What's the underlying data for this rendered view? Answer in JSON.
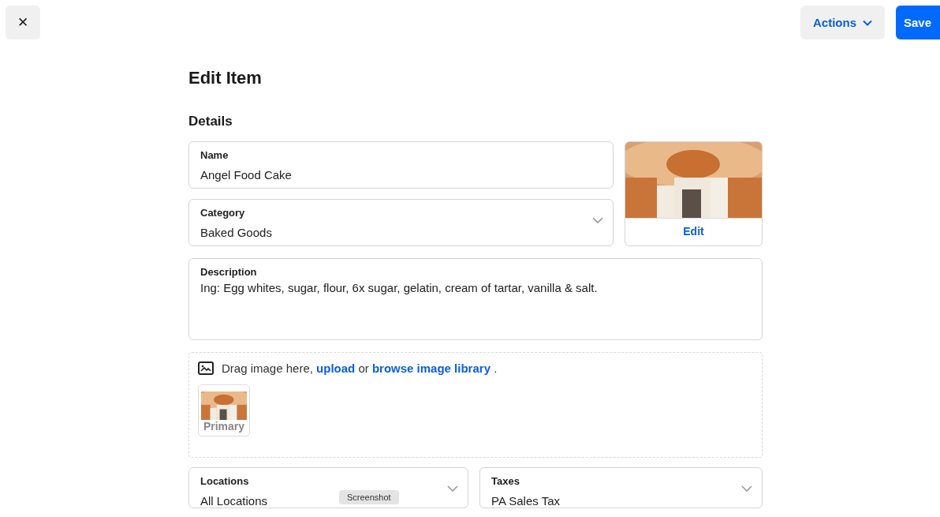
{
  "header": {
    "close": "✕",
    "actions": "Actions",
    "save": "Save"
  },
  "title": "Edit Item",
  "section": "Details",
  "name_field": {
    "label": "Name",
    "value": "Angel Food Cake"
  },
  "category_field": {
    "label": "Category",
    "value": "Baked Goods"
  },
  "image_card": {
    "kind": "picture",
    "edit": "Edit"
  },
  "description_field": {
    "label": "Description",
    "value": "Ing: Egg whites, sugar, flour, 6x sugar, gelatin, cream of tartar, vanilla & salt."
  },
  "dropzone": {
    "segments": [
      {
        "kind": "text",
        "text": "Drag image here, "
      },
      {
        "kind": "link",
        "text": "upload"
      },
      {
        "kind": "text",
        "text": " or "
      },
      {
        "kind": "link",
        "text": "browse image library"
      },
      {
        "kind": "text",
        "text": " ."
      }
    ],
    "thumbnails": [
      {
        "kind": "picture",
        "label": "Primary"
      }
    ]
  },
  "bottom_fields": [
    {
      "label": "Locations",
      "value": "All Locations"
    },
    {
      "label": "Taxes",
      "value": "PA Sales Tax"
    }
  ],
  "overlay_badge": "Screenshot"
}
